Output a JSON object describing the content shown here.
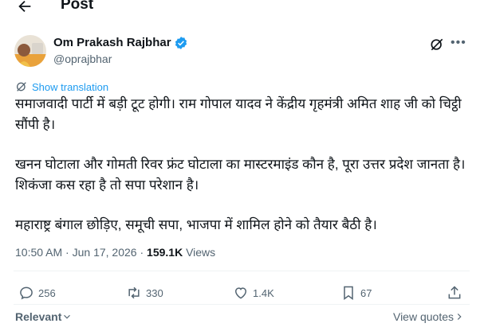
{
  "header": {
    "title": "Post"
  },
  "author": {
    "name": "Om Prakash Rajbhar",
    "handle": "@oprajbhar"
  },
  "translate_label": "Show translation",
  "post": {
    "para1": "समाजवादी पार्टी में बड़ी टूट होगी। राम गोपाल यादव ने केंद्रीय गृहमंत्री अमित शाह जी को चिट्ठी सौंपी है।",
    "para2": "खनन घोटाला और गोमती रिवर फ्रंट घोटाला का मास्टरमाइंड कौन है, पूरा उत्तर प्रदेश जानता है। शिकंजा कस रहा है तो सपा परेशान है।",
    "para3": "महाराष्ट्र बंगाल छोड़िए, समूची सपा, भाजपा में शामिल होने को तैयार बैठी है।"
  },
  "meta": {
    "time": "10:50 AM",
    "date": "Jun 17, 2026",
    "separator": "·",
    "views": "159.1K",
    "views_label": "Views"
  },
  "actions": {
    "replies": "256",
    "reposts": "330",
    "likes": "1.4K",
    "bookmarks": "67"
  },
  "footer": {
    "relevant": "Relevant",
    "view_quotes": "View quotes"
  },
  "colors": {
    "accent": "#1d9bf0",
    "text": "#0f1419",
    "muted": "#536471",
    "divider": "#eff3f4"
  },
  "icons": [
    "back-arrow-icon",
    "verified-badge-icon",
    "grok-icon",
    "more-icon",
    "translate-icon",
    "reply-icon",
    "repost-icon",
    "like-icon",
    "bookmark-icon",
    "share-icon",
    "chevron-down-icon",
    "chevron-right-icon"
  ]
}
